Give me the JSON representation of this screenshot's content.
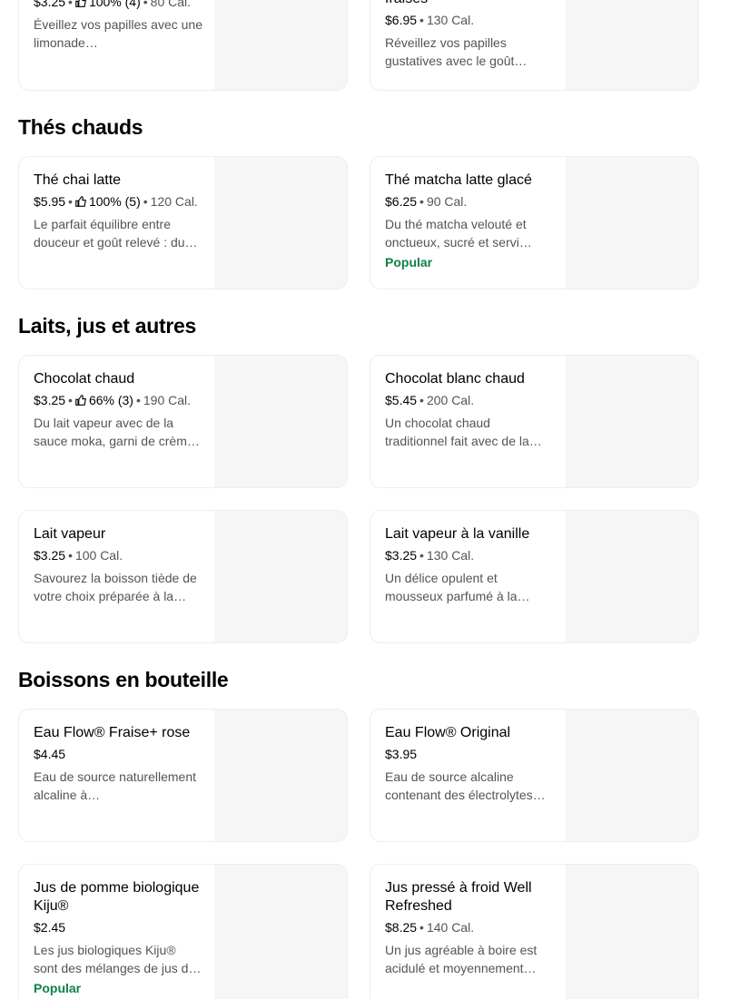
{
  "sections": {
    "hot_teas": "Thés chauds",
    "milks": "Laits, jus et autres",
    "bottled": "Boissons en bouteille"
  },
  "items": {
    "lemonade": {
      "price": "$3.25",
      "rating": "100% (4)",
      "cal": "80 Cal.",
      "desc": "Éveillez vos papilles avec une limonade…"
    },
    "strawberry": {
      "name": "fraises",
      "price": "$6.95",
      "cal": "130 Cal.",
      "desc": "Réveillez vos papilles gustatives avec le goût…"
    },
    "chai": {
      "name": "Thé chai latte",
      "price": "$5.95",
      "rating": "100% (5)",
      "cal": "120 Cal.",
      "desc": "Le parfait équilibre entre douceur et goût relevé : du…"
    },
    "matcha": {
      "name": "Thé matcha latte glacé",
      "price": "$6.25",
      "cal": "90 Cal.",
      "desc": "Du thé matcha velouté et onctueux, sucré et servi…",
      "badge": "Popular"
    },
    "hot_choc": {
      "name": "Chocolat chaud",
      "price": "$3.25",
      "rating": "66% (3)",
      "cal": "190 Cal.",
      "desc": "Du lait vapeur avec de la sauce moka, garni de crèm…"
    },
    "white_choc": {
      "name": "Chocolat blanc chaud",
      "price": "$5.45",
      "cal": "200 Cal.",
      "desc": "Un chocolat chaud traditionnel fait avec de la…"
    },
    "steamed_milk": {
      "name": "Lait vapeur",
      "price": "$3.25",
      "cal": "100 Cal.",
      "desc": "Savourez la boisson tiède de votre choix préparée à la…"
    },
    "vanilla_milk": {
      "name": "Lait vapeur à la vanille",
      "price": "$3.25",
      "cal": "130 Cal.",
      "desc": "Un délice opulent et mousseux parfumé à la…"
    },
    "flow_rose": {
      "name": "Eau Flow® Fraise+ rose",
      "price": "$4.45",
      "desc": "Eau de source naturellement alcaline à…"
    },
    "flow_original": {
      "name": "Eau Flow® Original",
      "price": "$3.95",
      "desc": "Eau de source alcaline contenant des électrolytes…"
    },
    "kiju": {
      "name": "Jus de pomme biologique Kiju®",
      "price": "$2.45",
      "desc": "Les jus biologiques Kiju® sont des mélanges de jus d…",
      "badge": "Popular"
    },
    "well_refreshed": {
      "name": "Jus pressé à froid Well Refreshed",
      "price": "$8.25",
      "cal": "140 Cal.",
      "desc": "Un jus agréable à boire est acidulé et moyennement…"
    }
  },
  "colors": {
    "popular": "#0e8345",
    "muted": "#545454",
    "image_placeholder": "#f6f6f6"
  },
  "icons": {
    "rating": "thumbs-up-icon"
  }
}
